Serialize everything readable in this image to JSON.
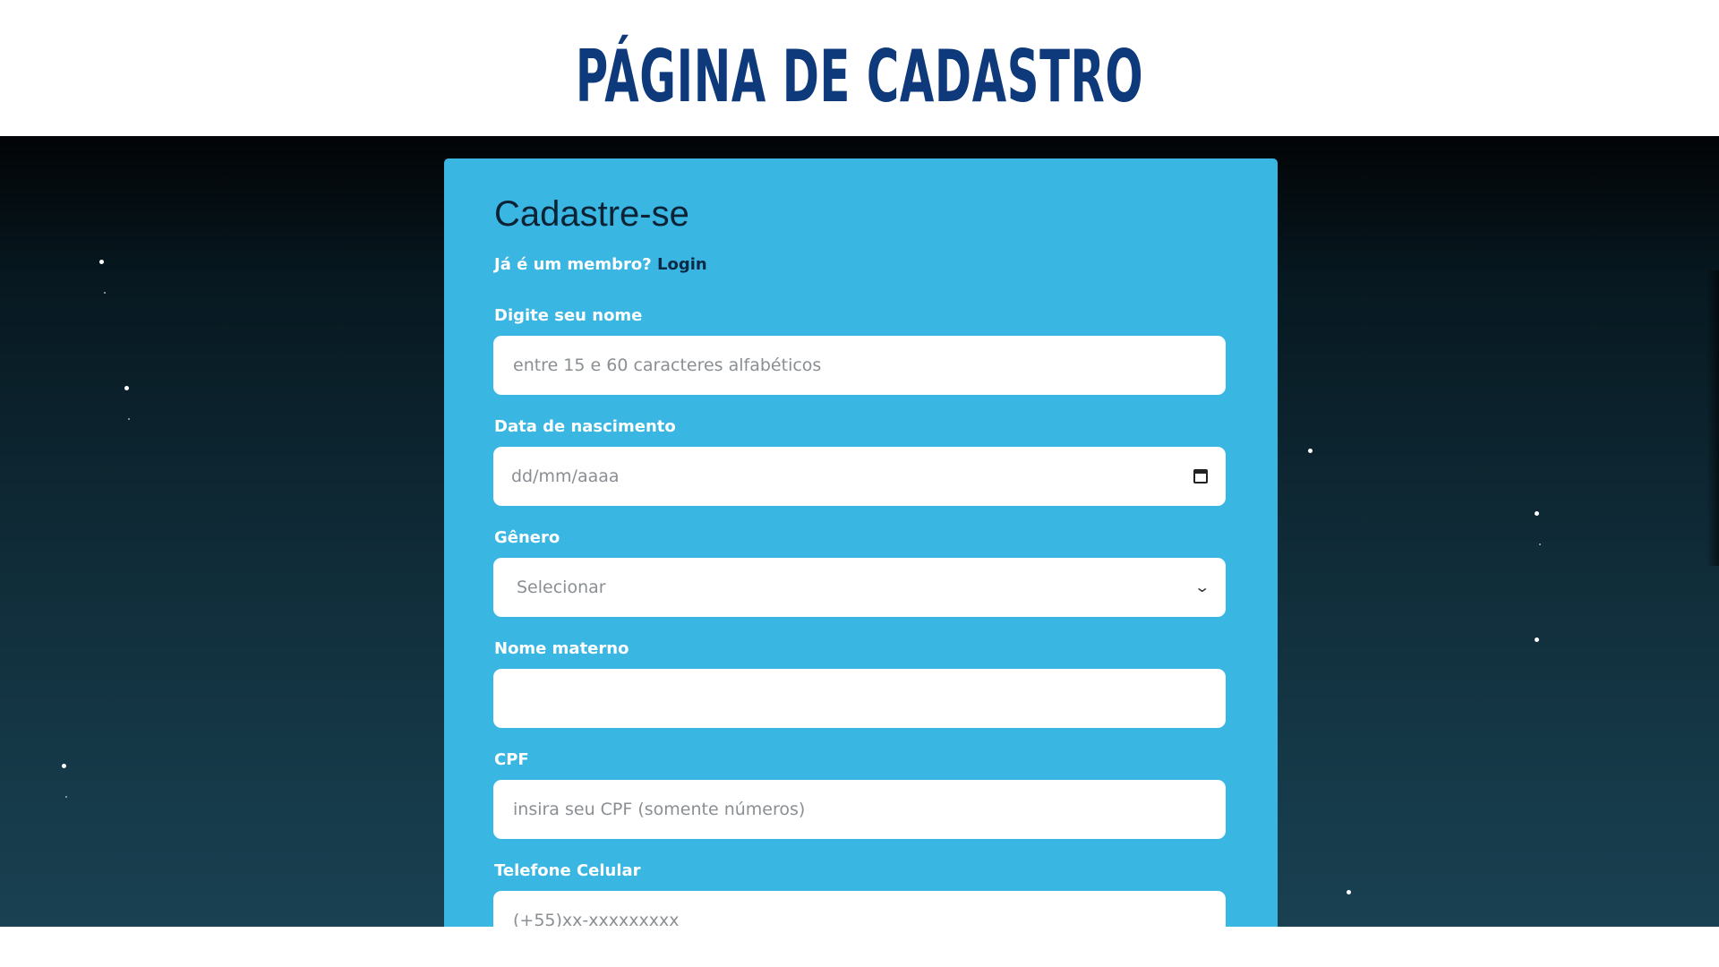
{
  "slide": {
    "title": "PÁGINA DE CADASTRO"
  },
  "form": {
    "heading": "Cadastre-se",
    "member_prompt": "Já é um membro?",
    "login_link": "Login",
    "fields": [
      {
        "label": "Digite seu nome",
        "placeholder": "entre 15 e 60 caracteres alfabéticos",
        "value": ""
      },
      {
        "label": "Data de nascimento",
        "placeholder": "dd/mm/aaaa",
        "value": ""
      },
      {
        "label": "Gênero",
        "placeholder": "Selecionar",
        "value": ""
      },
      {
        "label": "Nome materno",
        "placeholder": "",
        "value": ""
      },
      {
        "label": "CPF",
        "placeholder": "insira seu CPF (somente números)",
        "value": ""
      },
      {
        "label": "Telefone Celular",
        "placeholder": "(+55)xx-xxxxxxxxx",
        "value": ""
      }
    ]
  },
  "colors": {
    "title": "#0e3a7c",
    "card": "#3ab6e2",
    "background_top": "#020406",
    "background_bottom": "#194152"
  },
  "icons": {
    "date_field": "calendar-icon",
    "gender_field": "chevron-down-icon"
  }
}
